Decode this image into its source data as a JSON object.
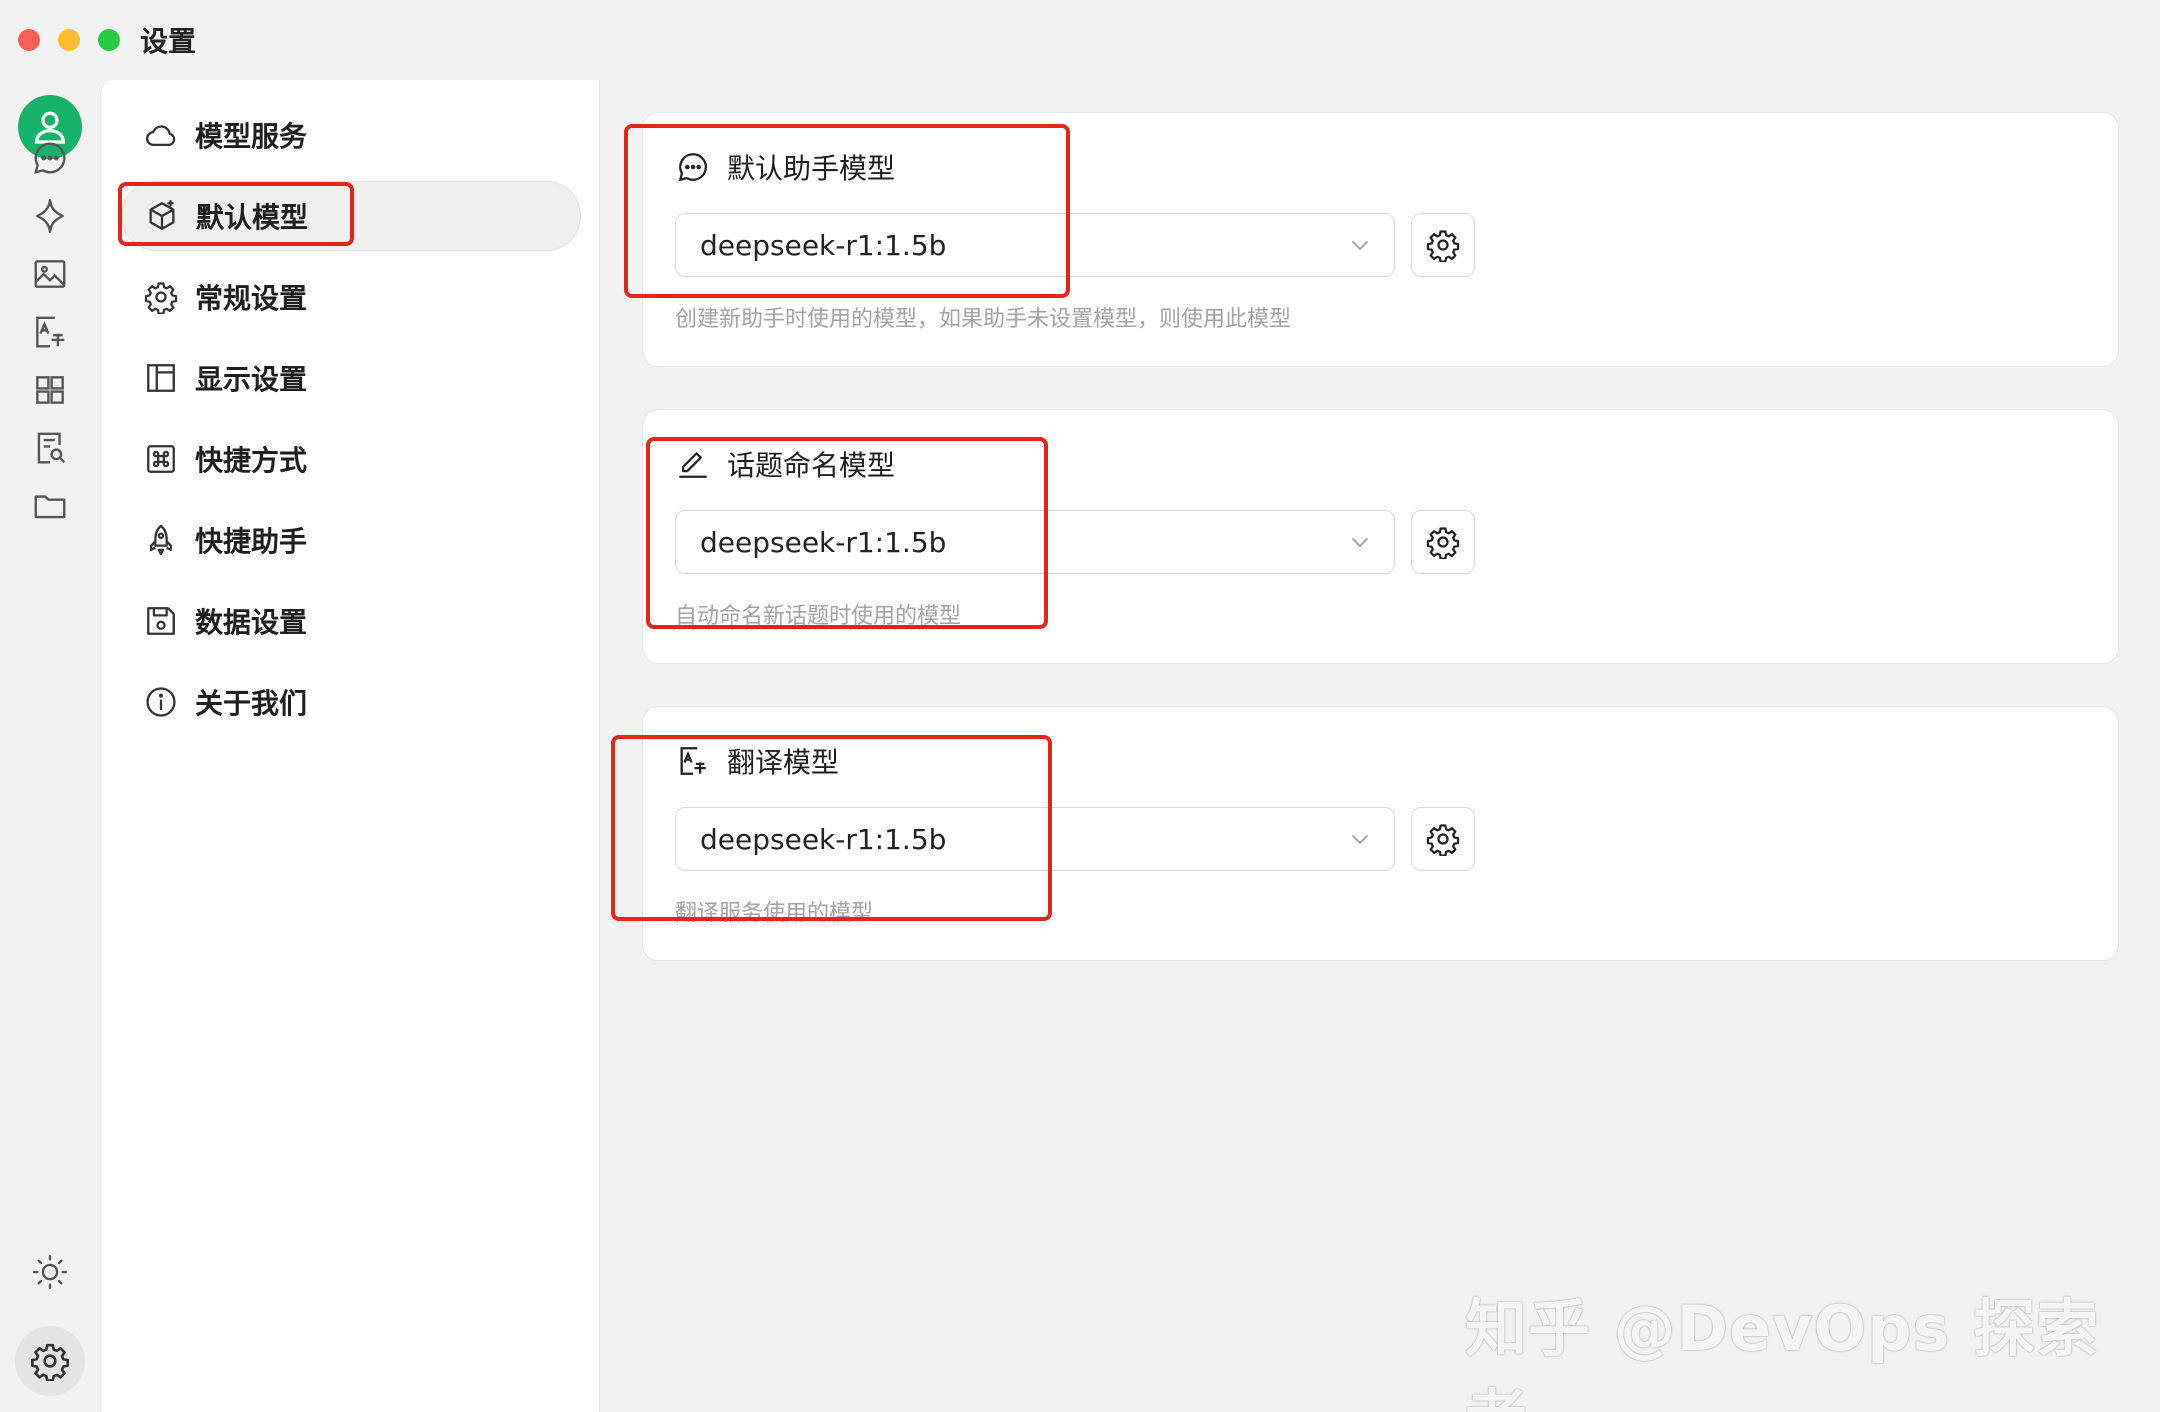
{
  "window": {
    "title": "设置"
  },
  "rail": {
    "icons": [
      "user-icon",
      "chat-icon",
      "sparkle-icon",
      "image-icon",
      "translate-icon",
      "apps-icon",
      "search-doc-icon",
      "folder-icon",
      "sun-icon",
      "gear-icon"
    ],
    "accent": "#17b26a"
  },
  "menu": {
    "items": [
      {
        "label": "模型服务",
        "icon": "cloud-icon"
      },
      {
        "label": "默认模型",
        "icon": "cube-icon",
        "active": true
      },
      {
        "label": "常规设置",
        "icon": "gear-icon"
      },
      {
        "label": "显示设置",
        "icon": "layout-icon"
      },
      {
        "label": "快捷方式",
        "icon": "command-icon"
      },
      {
        "label": "快捷助手",
        "icon": "rocket-icon"
      },
      {
        "label": "数据设置",
        "icon": "save-icon"
      },
      {
        "label": "关于我们",
        "icon": "info-icon"
      }
    ]
  },
  "cards": [
    {
      "title": "默认助手模型",
      "icon": "chat-icon",
      "selected": "deepseek-r1:1.5b",
      "hint": "创建新助手时使用的模型，如果助手未设置模型，则使用此模型"
    },
    {
      "title": "话题命名模型",
      "icon": "edit-icon",
      "selected": "deepseek-r1:1.5b",
      "hint": "自动命名新话题时使用的模型"
    },
    {
      "title": "翻译模型",
      "icon": "translate-icon",
      "selected": "deepseek-r1:1.5b",
      "hint": "翻译服务使用的模型"
    }
  ],
  "annotation_color": "#e2261c",
  "watermark": "知乎 @DevOps 探索者"
}
